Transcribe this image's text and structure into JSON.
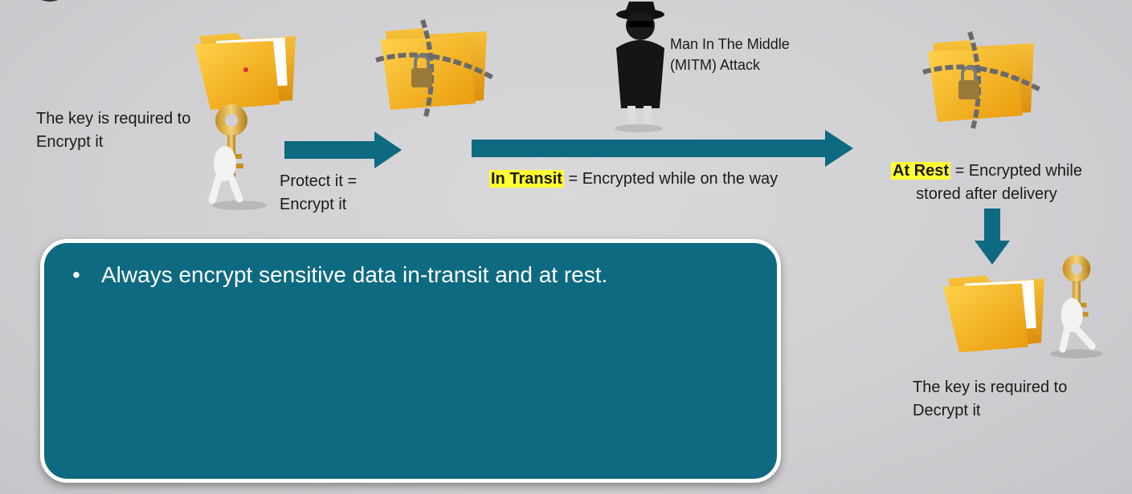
{
  "corner_avatar": {
    "icon": "presenter-avatar-icon"
  },
  "step_encrypt": {
    "caption": "The key is required to Encrypt it",
    "line1": "The key is required to",
    "line2": "Encrypt it",
    "folder_icon": "open-folder-icon",
    "figure_icon": "figure-holding-key-icon"
  },
  "arrow_protect": {
    "line1": "Protect it =",
    "line2": "Encrypt it"
  },
  "locked_folder": {
    "icon": "chained-locked-folder-icon"
  },
  "mitm": {
    "line1": "Man In The Middle",
    "line2": "(MITM) Attack",
    "icon": "spy-figure-icon"
  },
  "in_transit": {
    "highlight": "In Transit",
    "rest": " = Encrypted while on the way"
  },
  "at_rest": {
    "highlight": "At Rest",
    "rest": " = Encrypted while",
    "line2": "stored after delivery",
    "icon": "chained-locked-folder-icon"
  },
  "step_decrypt": {
    "line1": "The key is required to",
    "line2": "Decrypt it",
    "folder_icon": "open-folder-icon",
    "figure_icon": "figure-holding-key-icon"
  },
  "panel": {
    "bullet": "•",
    "text": "Always encrypt sensitive data in-transit and at rest."
  },
  "colors": {
    "arrow": "#0e6a80",
    "panel": "#0e6a80",
    "highlight": "#ffff33",
    "folder": "#f5b623"
  }
}
